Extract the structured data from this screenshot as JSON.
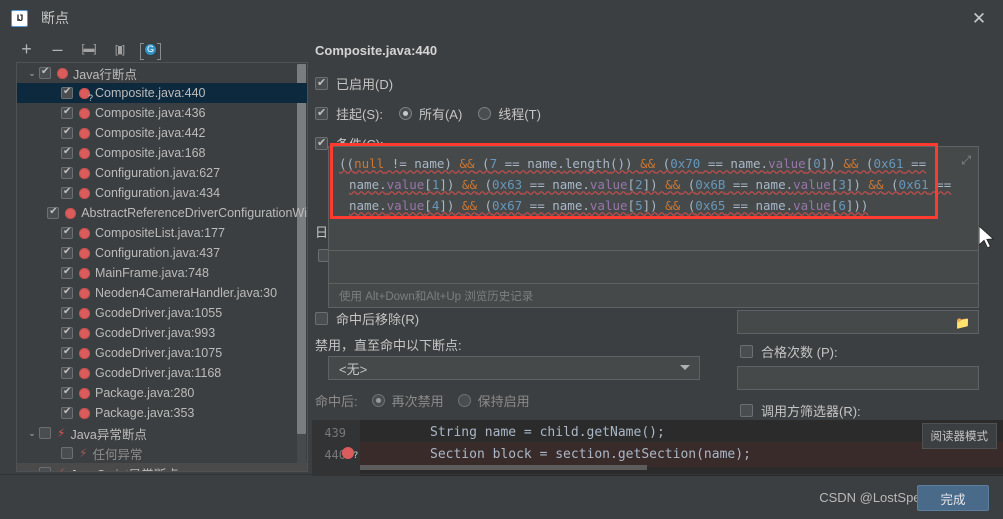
{
  "window": {
    "title": "断点",
    "logo_text": "IJ",
    "close_label": "✕"
  },
  "toolbar": {
    "add_label": "+",
    "remove_label": "–",
    "group_label": "[▬]",
    "save_label": "[▮]",
    "mute_label": "G"
  },
  "tree": {
    "rows": [
      {
        "label": "Java行断点",
        "depth": 0,
        "chevron": "⌄",
        "checkbox": "checked",
        "icon": "breakpoint-dot",
        "selected": false
      },
      {
        "label": "Composite.java:440",
        "depth": 1,
        "chevron": "",
        "checkbox": "checked",
        "icon": "breakpoint-dot-conditional",
        "selected": true
      },
      {
        "label": "Composite.java:436",
        "depth": 1,
        "chevron": "",
        "checkbox": "checked",
        "icon": "breakpoint-dot",
        "selected": false
      },
      {
        "label": "Composite.java:442",
        "depth": 1,
        "chevron": "",
        "checkbox": "checked",
        "icon": "breakpoint-dot",
        "selected": false
      },
      {
        "label": "Composite.java:168",
        "depth": 1,
        "chevron": "",
        "checkbox": "checked",
        "icon": "breakpoint-dot",
        "selected": false
      },
      {
        "label": "Configuration.java:627",
        "depth": 1,
        "chevron": "",
        "checkbox": "checked",
        "icon": "breakpoint-dot",
        "selected": false
      },
      {
        "label": "Configuration.java:434",
        "depth": 1,
        "chevron": "",
        "checkbox": "checked",
        "icon": "breakpoint-dot",
        "selected": false
      },
      {
        "label": "AbstractReferenceDriverConfigurationWi",
        "depth": 1,
        "chevron": "",
        "checkbox": "checked",
        "icon": "breakpoint-dot",
        "selected": false
      },
      {
        "label": "CompositeList.java:177",
        "depth": 1,
        "chevron": "",
        "checkbox": "checked",
        "icon": "breakpoint-dot",
        "selected": false
      },
      {
        "label": "Configuration.java:437",
        "depth": 1,
        "chevron": "",
        "checkbox": "checked",
        "icon": "breakpoint-dot",
        "selected": false
      },
      {
        "label": "MainFrame.java:748",
        "depth": 1,
        "chevron": "",
        "checkbox": "checked",
        "icon": "breakpoint-dot",
        "selected": false
      },
      {
        "label": "Neoden4CameraHandler.java:30",
        "depth": 1,
        "chevron": "",
        "checkbox": "checked",
        "icon": "breakpoint-dot",
        "selected": false
      },
      {
        "label": "GcodeDriver.java:1055",
        "depth": 1,
        "chevron": "",
        "checkbox": "checked",
        "icon": "breakpoint-dot",
        "selected": false
      },
      {
        "label": "GcodeDriver.java:993",
        "depth": 1,
        "chevron": "",
        "checkbox": "checked",
        "icon": "breakpoint-dot",
        "selected": false
      },
      {
        "label": "GcodeDriver.java:1075",
        "depth": 1,
        "chevron": "",
        "checkbox": "checked",
        "icon": "breakpoint-dot",
        "selected": false
      },
      {
        "label": "GcodeDriver.java:1168",
        "depth": 1,
        "chevron": "",
        "checkbox": "checked",
        "icon": "breakpoint-dot",
        "selected": false
      },
      {
        "label": "Package.java:280",
        "depth": 1,
        "chevron": "",
        "checkbox": "checked",
        "icon": "breakpoint-dot",
        "selected": false
      },
      {
        "label": "Package.java:353",
        "depth": 1,
        "chevron": "",
        "checkbox": "checked",
        "icon": "breakpoint-dot",
        "selected": false
      },
      {
        "label": "Java异常断点",
        "depth": 0,
        "chevron": "⌄",
        "checkbox": "unchecked",
        "icon": "bolt",
        "selected": false
      },
      {
        "label": "任何异常",
        "depth": 1,
        "chevron": "",
        "checkbox": "unchecked",
        "icon": "bolt-dim",
        "selected": false,
        "dim": true
      },
      {
        "label": "JavaScript异常断点",
        "depth": 0,
        "chevron": "⌄",
        "checkbox": "unchecked",
        "icon": "bolt",
        "selected": false,
        "partial": true
      }
    ]
  },
  "help": {
    "label": "?"
  },
  "details": {
    "title": "Composite.java:440",
    "enabled_label": "已启用(D)",
    "enabled_checked": true,
    "suspend_label": "挂起(S):",
    "suspend_checked": true,
    "suspend_all_label": "所有(A)",
    "suspend_thread_label": "线程(T)",
    "suspend_selected": "all",
    "condition_label": "条件(C):",
    "condition_checked": true,
    "condition_code_line1_a": "((",
    "condition_code": "((null != name) && (7 == name.length()) && (0x70 == name.value[0]) && (0x61 == name.value[1]) && (0x63 == name.value[2]) && (0x6B == name.value[3]) && (0x61 == name.value[4]) && (0x67 == name.value[5]) && (0x65 == name.value[6]))",
    "condition_hint": "使用 Alt+Down和Alt+Up 浏览历史记录",
    "log_label": "日志",
    "remove_after_hit_label": "命中后移除(R)",
    "remove_after_hit_checked": false,
    "disable_until_label": "禁用，直至命中以下断点:",
    "disable_until_value": "<无>",
    "after_hit_label": "命中后:",
    "after_hit_disable_again_label": "再次禁用",
    "after_hit_keep_enabled_label": "保持启用",
    "after_hit_selected": "disable_again",
    "pass_count_label": "合格次数 (P):",
    "pass_count_checked": false,
    "pass_count_value": "",
    "caller_filter_label": "调用方筛选器(R):",
    "caller_filter_checked": false,
    "caller_filter_value": "",
    "class_filter_value": ""
  },
  "condition_tokens": [
    [
      {
        "t": "((",
        "c": "plain"
      },
      {
        "t": "null",
        "c": "kw"
      },
      {
        "t": " != name) ",
        "c": "plain"
      },
      {
        "t": "&&",
        "c": "kw"
      },
      {
        "t": " (",
        "c": "plain"
      },
      {
        "t": "7",
        "c": "num"
      },
      {
        "t": " == name.",
        "c": "plain"
      },
      {
        "t": "length",
        "c": "plain"
      },
      {
        "t": "()) ",
        "c": "plain"
      },
      {
        "t": "&&",
        "c": "kw"
      },
      {
        "t": " (",
        "c": "plain"
      },
      {
        "t": "0x70",
        "c": "num"
      },
      {
        "t": " == name.",
        "c": "plain"
      },
      {
        "t": "value",
        "c": "field"
      },
      {
        "t": "[",
        "c": "plain"
      },
      {
        "t": "0",
        "c": "num"
      },
      {
        "t": "]) ",
        "c": "plain"
      },
      {
        "t": "&&",
        "c": "kw"
      },
      {
        "t": " (",
        "c": "plain"
      },
      {
        "t": "0x61",
        "c": "num"
      },
      {
        "t": " ==",
        "c": "plain"
      }
    ],
    [
      {
        "t": "name.",
        "c": "plain"
      },
      {
        "t": "value",
        "c": "field"
      },
      {
        "t": "[",
        "c": "plain"
      },
      {
        "t": "1",
        "c": "num"
      },
      {
        "t": "]) ",
        "c": "plain"
      },
      {
        "t": "&&",
        "c": "kw"
      },
      {
        "t": " (",
        "c": "plain"
      },
      {
        "t": "0x63",
        "c": "num"
      },
      {
        "t": " == name.",
        "c": "plain"
      },
      {
        "t": "value",
        "c": "field"
      },
      {
        "t": "[",
        "c": "plain"
      },
      {
        "t": "2",
        "c": "num"
      },
      {
        "t": "]) ",
        "c": "plain"
      },
      {
        "t": "&&",
        "c": "kw"
      },
      {
        "t": " (",
        "c": "plain"
      },
      {
        "t": "0x6B",
        "c": "num"
      },
      {
        "t": " == name.",
        "c": "plain"
      },
      {
        "t": "value",
        "c": "field"
      },
      {
        "t": "[",
        "c": "plain"
      },
      {
        "t": "3",
        "c": "num"
      },
      {
        "t": "]) ",
        "c": "plain"
      },
      {
        "t": "&&",
        "c": "kw"
      },
      {
        "t": " (",
        "c": "plain"
      },
      {
        "t": "0x61",
        "c": "num"
      },
      {
        "t": " ==",
        "c": "plain"
      }
    ],
    [
      {
        "t": "name.",
        "c": "plain"
      },
      {
        "t": "value",
        "c": "field"
      },
      {
        "t": "[",
        "c": "plain"
      },
      {
        "t": "4",
        "c": "num"
      },
      {
        "t": "]) ",
        "c": "plain"
      },
      {
        "t": "&&",
        "c": "kw"
      },
      {
        "t": " (",
        "c": "plain"
      },
      {
        "t": "0x67",
        "c": "num"
      },
      {
        "t": " == name.",
        "c": "plain"
      },
      {
        "t": "value",
        "c": "field"
      },
      {
        "t": "[",
        "c": "plain"
      },
      {
        "t": "5",
        "c": "num"
      },
      {
        "t": "]) ",
        "c": "plain"
      },
      {
        "t": "&&",
        "c": "kw"
      },
      {
        "t": " (",
        "c": "plain"
      },
      {
        "t": "0x65",
        "c": "num"
      },
      {
        "t": " == name.",
        "c": "plain"
      },
      {
        "t": "value",
        "c": "field"
      },
      {
        "t": "[",
        "c": "plain"
      },
      {
        "t": "6",
        "c": "num"
      },
      {
        "t": "]))",
        "c": "plain"
      }
    ]
  ],
  "code_preview": {
    "lines": [
      {
        "number": "439",
        "text": "String name = child.getName();",
        "breakpoint": false
      },
      {
        "number": "440",
        "text": "Section block = section.getSection(name);",
        "breakpoint": true
      }
    ],
    "reader_mode_label": "阅读器模式"
  },
  "footer": {
    "watermark": "CSDN @LostSpeed",
    "done_label": "完成"
  },
  "colors": {
    "accent_red": "#ff3b30",
    "breakpoint_red": "#db5c5c",
    "selection_blue": "#0d293e",
    "button_blue": "#4a6a8a",
    "keyword_orange": "#cc7832",
    "number_blue": "#6897bb",
    "field_purple": "#9876aa"
  }
}
